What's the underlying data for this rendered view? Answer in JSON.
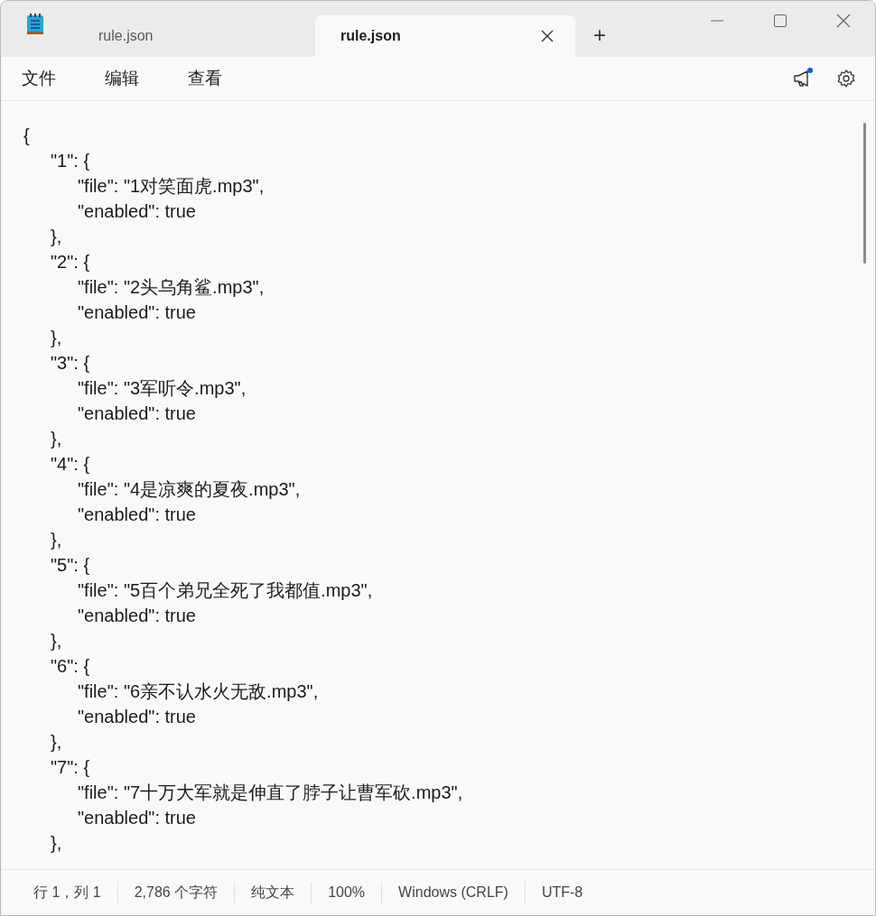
{
  "tabs": [
    {
      "label": "rule.json",
      "selected": false
    },
    {
      "label": "rule.json",
      "selected": true
    }
  ],
  "new_tab": "+",
  "menu": [
    "文件",
    "编辑",
    "查看"
  ],
  "notification_unread": true,
  "editor_lines": [
    "{",
    "\t\"1\": {",
    "\t\t\"file\": \"1对笑面虎.mp3\",",
    "\t\t\"enabled\": true",
    "\t},",
    "\t\"2\": {",
    "\t\t\"file\": \"2头乌角鲨.mp3\",",
    "\t\t\"enabled\": true",
    "\t},",
    "\t\"3\": {",
    "\t\t\"file\": \"3军听令.mp3\",",
    "\t\t\"enabled\": true",
    "\t},",
    "\t\"4\": {",
    "\t\t\"file\": \"4是凉爽的夏夜.mp3\",",
    "\t\t\"enabled\": true",
    "\t},",
    "\t\"5\": {",
    "\t\t\"file\": \"5百个弟兄全死了我都值.mp3\",",
    "\t\t\"enabled\": true",
    "\t},",
    "\t\"6\": {",
    "\t\t\"file\": \"6亲不认水火无敌.mp3\",",
    "\t\t\"enabled\": true",
    "\t},",
    "\t\"7\": {",
    "\t\t\"file\": \"7十万大军就是伸直了脖子让曹军砍.mp3\",",
    "\t\t\"enabled\": true",
    "\t},"
  ],
  "status_bar": [
    "行 1，列 1",
    "2,786 个字符",
    "纯文本",
    "100%",
    "Windows (CRLF)",
    "UTF-8"
  ]
}
